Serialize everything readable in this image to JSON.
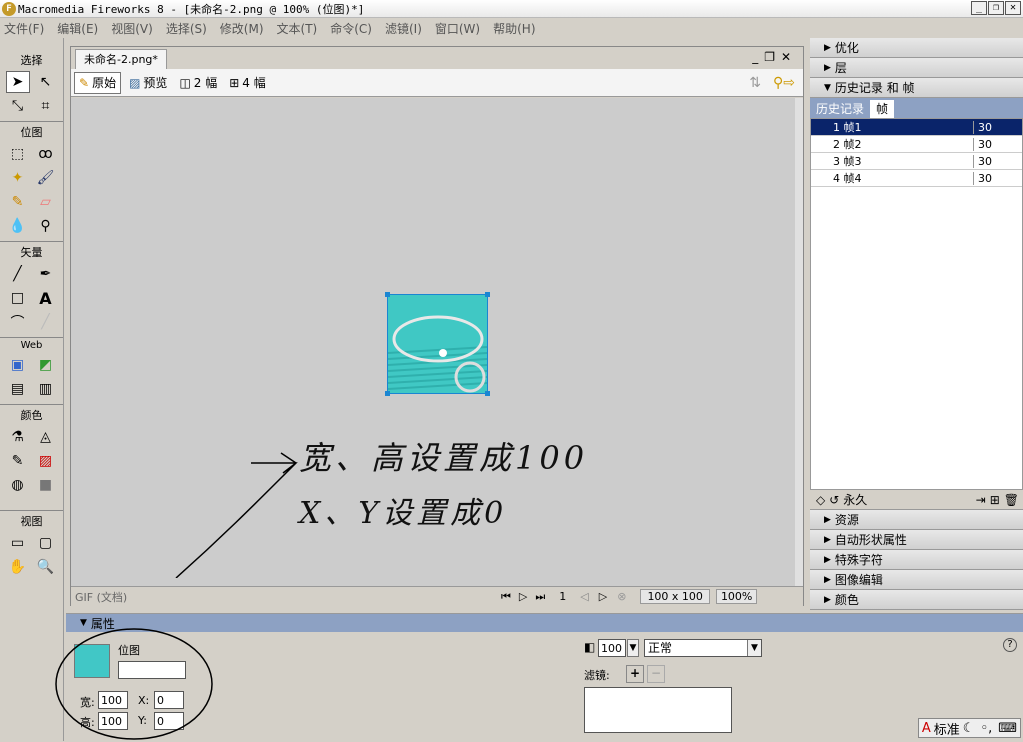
{
  "titlebar": {
    "title": "Macromedia Fireworks 8 - [未命名-2.png @ 100% (位图)*]"
  },
  "menu": [
    "文件(F)",
    "编辑(E)",
    "视图(V)",
    "选择(S)",
    "修改(M)",
    "文本(T)",
    "命令(C)",
    "滤镜(I)",
    "窗口(W)",
    "帮助(H)"
  ],
  "tools": {
    "select": "选择",
    "bitmap": "位图",
    "vector": "矢量",
    "web": "Web",
    "colors": "颜色",
    "view": "视图"
  },
  "doc": {
    "tab": "未命名-2.png*",
    "views": {
      "original": "原始",
      "preview": "预览",
      "two_up": "2 幅",
      "four_up": "4 幅"
    },
    "status": {
      "format": "GIF (文档)",
      "frame": "1",
      "size": "100 x 100",
      "zoom": "100%"
    }
  },
  "panels": {
    "optimize": "优化",
    "layers": "层",
    "history_frames": "历史记录 和 帧",
    "tab_history": "历史记录",
    "tab_frames": "帧",
    "frames": [
      {
        "num": "1",
        "name": "帧1",
        "delay": "30"
      },
      {
        "num": "2",
        "name": "帧2",
        "delay": "30"
      },
      {
        "num": "3",
        "name": "帧3",
        "delay": "30"
      },
      {
        "num": "4",
        "name": "帧4",
        "delay": "30"
      }
    ],
    "loop": "永久",
    "assets": "资源",
    "autoshape": "自动形状属性",
    "special_chars": "特殊字符",
    "image_edit": "图像编辑",
    "colors": "颜色"
  },
  "props": {
    "title": "属性",
    "type": "位图",
    "name_value": "",
    "w_label": "宽:",
    "h_label": "高:",
    "x_label": "X:",
    "y_label": "Y:",
    "w": "100",
    "h": "100",
    "x": "0",
    "y": "0",
    "opacity": "100",
    "blend": "正常",
    "filters": "滤镜:"
  },
  "annotation": {
    "line1": "宽、高设置成100",
    "line2": "X、Y设置成0"
  },
  "status_right": {
    "mode": "标准"
  }
}
